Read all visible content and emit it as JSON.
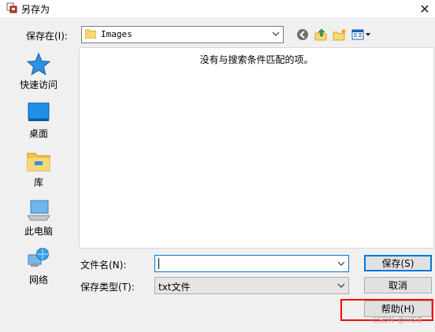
{
  "window": {
    "title": "另存为",
    "close_glyph": "✕"
  },
  "save_in": {
    "label": "保存在(I):",
    "value": "Images"
  },
  "places": [
    {
      "label": "快速访问",
      "icon": "star-icon"
    },
    {
      "label": "桌面",
      "icon": "desktop-icon"
    },
    {
      "label": "库",
      "icon": "library-icon"
    },
    {
      "label": "此电脑",
      "icon": "computer-icon"
    },
    {
      "label": "网络",
      "icon": "network-icon"
    }
  ],
  "file_list": {
    "empty_message": "没有与搜索条件匹配的项。"
  },
  "file_name": {
    "label": "文件名(N):",
    "value": ""
  },
  "file_type": {
    "label": "保存类型(T):",
    "value": "txt文件"
  },
  "buttons": {
    "save": "保存(S)",
    "cancel": "取消",
    "help": "帮助(H)"
  },
  "watermark": "CSDN @HGB",
  "colors": {
    "accent": "#0078d7",
    "highlight": "#ff0000"
  }
}
